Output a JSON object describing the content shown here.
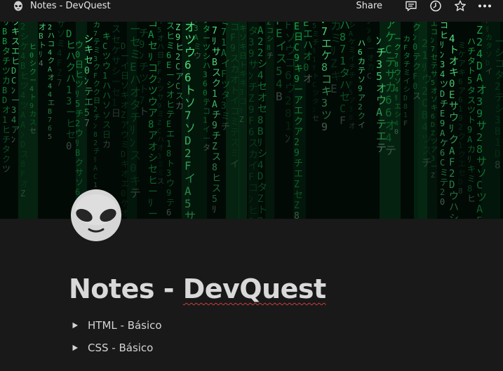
{
  "topbar": {
    "page_icon": "alien-icon",
    "breadcrumb_title": "Notes - DevQuest",
    "share_label": "Share",
    "icons": [
      "comment-icon",
      "clock-icon",
      "star-icon",
      "more-icon"
    ]
  },
  "cover": {
    "description_icon": "matrix-cover-image",
    "accent": "#10d34a"
  },
  "page": {
    "icon": "alien-icon",
    "title_part1": "Notes - ",
    "title_part2": "DevQuest",
    "toggles": [
      {
        "label": "HTML - Básico"
      },
      {
        "label": "CSS - Básico"
      }
    ]
  },
  "colors": {
    "background": "#191919",
    "text": "#d4d4d4",
    "spellcheck": "#d13b3b"
  }
}
